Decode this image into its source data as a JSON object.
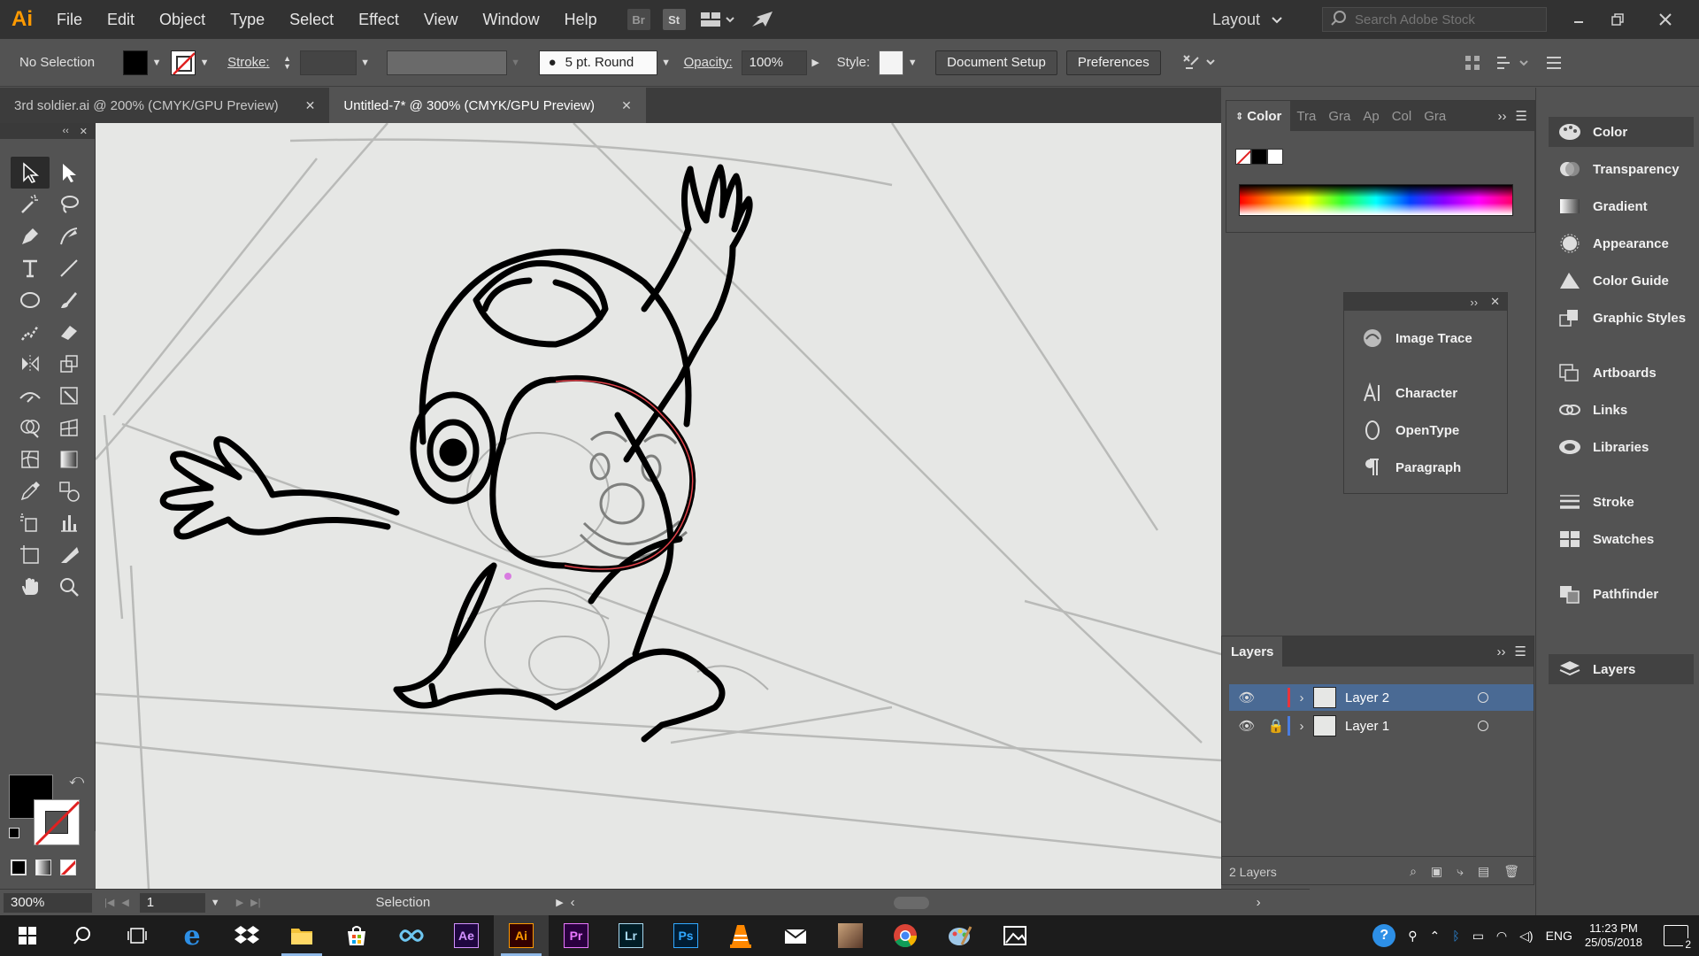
{
  "app": {
    "logo": "Ai",
    "menu": [
      "File",
      "Edit",
      "Object",
      "Type",
      "Select",
      "Effect",
      "View",
      "Window",
      "Help"
    ],
    "bridge_label": "Br",
    "stock_label": "St",
    "workspace": "Layout",
    "search_placeholder": "Search Adobe Stock"
  },
  "control_bar": {
    "selection": "No Selection",
    "stroke_label": "Stroke:",
    "brush": "5 pt. Round",
    "opacity_label": "Opacity:",
    "opacity_value": "100%",
    "style_label": "Style:",
    "document_setup": "Document Setup",
    "preferences": "Preferences"
  },
  "tabs": [
    {
      "label": "3rd soldier.ai @ 200% (CMYK/GPU Preview)",
      "active": false
    },
    {
      "label": "Untitled-7* @ 300% (CMYK/GPU Preview)",
      "active": true
    }
  ],
  "color_panel": {
    "active_tab": "Color",
    "tabs": [
      "Tra",
      "Gra",
      "Ap",
      "Col",
      "Gra"
    ]
  },
  "type_panel": {
    "items": [
      "Image Trace",
      "Character",
      "OpenType",
      "Paragraph"
    ]
  },
  "layers_panel": {
    "title": "Layers",
    "layers": [
      {
        "name": "Layer 2",
        "selected": true,
        "locked": false,
        "color": "#e8343c"
      },
      {
        "name": "Layer 1",
        "selected": false,
        "locked": true,
        "color": "#4a7de0"
      }
    ],
    "count": "2 Layers"
  },
  "dock": {
    "items": [
      "Color",
      "Transparency",
      "Gradient",
      "Appearance",
      "Color Guide",
      "Graphic Styles",
      "Artboards",
      "Links",
      "Libraries",
      "Stroke",
      "Swatches",
      "Pathfinder",
      "Layers"
    ]
  },
  "status_bar": {
    "zoom": "300%",
    "artboard": "1",
    "tool": "Selection"
  },
  "taskbar": {
    "apps": [
      "start-icon",
      "search-icon",
      "task-view-icon",
      "edge-icon",
      "dropbox-icon",
      "file-explorer-icon",
      "store-icon",
      "infinity-icon",
      "after-effects-icon",
      "illustrator-icon",
      "premiere-icon",
      "lightroom-icon",
      "photoshop-icon",
      "vlc-icon",
      "mail-icon",
      "avatar-icon",
      "chrome-icon",
      "paint-icon",
      "photos-icon"
    ],
    "after_effects": "Ae",
    "illustrator": "Ai",
    "premiere": "Pr",
    "lightroom": "Lr",
    "photoshop": "Ps",
    "language": "ENG",
    "time": "11:23 PM",
    "date": "25/05/2018",
    "notifications": "2"
  },
  "colors": {
    "ai_orange": "#ff9a00",
    "selection_blue": "#4a6a94"
  }
}
